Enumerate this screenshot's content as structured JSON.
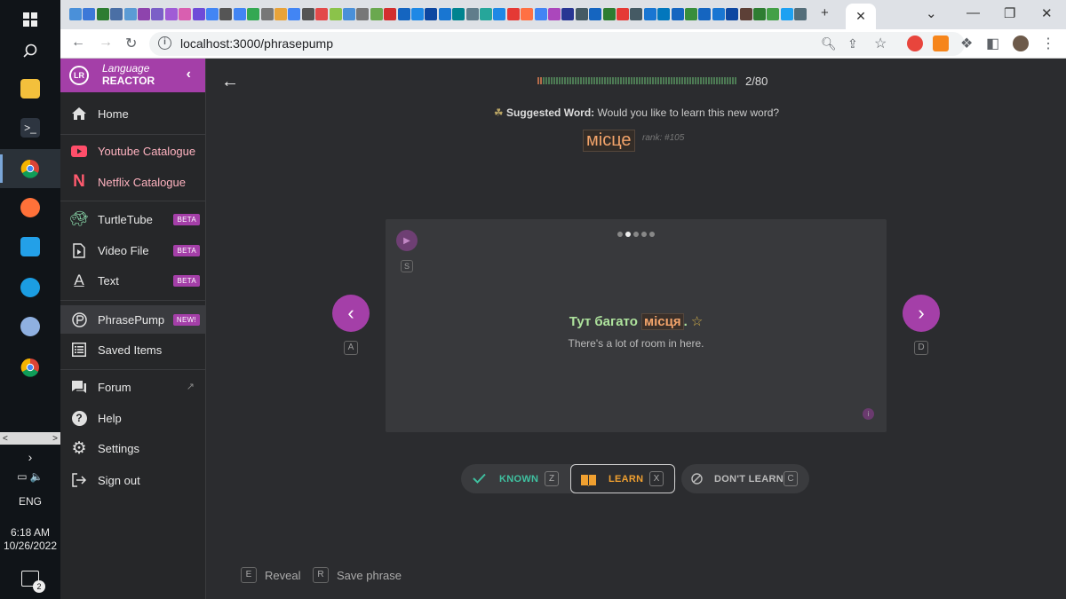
{
  "taskbar": {
    "language": "ENG",
    "time": "6:18 AM",
    "date": "10/26/2022",
    "notification_count": "2"
  },
  "browser": {
    "url": "localhost:3000/phrasepump"
  },
  "sidebar": {
    "brand_line1": "Language",
    "brand_line2": "REACTOR",
    "items": [
      {
        "label": "Home"
      },
      {
        "label": "Youtube Catalogue"
      },
      {
        "label": "Netflix Catalogue"
      },
      {
        "label": "TurtleTube",
        "badge": "BETA"
      },
      {
        "label": "Video File",
        "badge": "BETA"
      },
      {
        "label": "Text",
        "badge": "BETA"
      },
      {
        "label": "PhrasePump",
        "badge": "NEW!"
      },
      {
        "label": "Saved Items"
      },
      {
        "label": "Forum"
      },
      {
        "label": "Help"
      },
      {
        "label": "Settings"
      },
      {
        "label": "Sign out"
      }
    ]
  },
  "main": {
    "progress_text": "2/80",
    "progress_fraction": 0.025,
    "suggest_label": "Suggested Word:",
    "suggest_text": "Would you like to learn this new word?",
    "word": "місце",
    "rank": "rank: #105",
    "card": {
      "sentence_before": "Тут багато ",
      "sentence_highlight": "місця",
      "sentence_after": ".",
      "translation": "There's a lot of room in here.",
      "play_key": "S",
      "dots_total": 5,
      "dots_active": 2
    },
    "prev_key": "A",
    "next_key": "D",
    "actions": {
      "known": {
        "label": "KNOWN",
        "key": "Z"
      },
      "learn": {
        "label": "LEARN",
        "key": "X"
      },
      "dont": {
        "label": "DON'T LEARN",
        "key": "C"
      }
    },
    "footer": {
      "reveal_key": "E",
      "reveal_label": "Reveal",
      "save_key": "R",
      "save_label": "Save phrase"
    }
  },
  "colors": {
    "accent": "#a43fa8",
    "known": "#3fc1a0",
    "learn": "#f0a030"
  }
}
